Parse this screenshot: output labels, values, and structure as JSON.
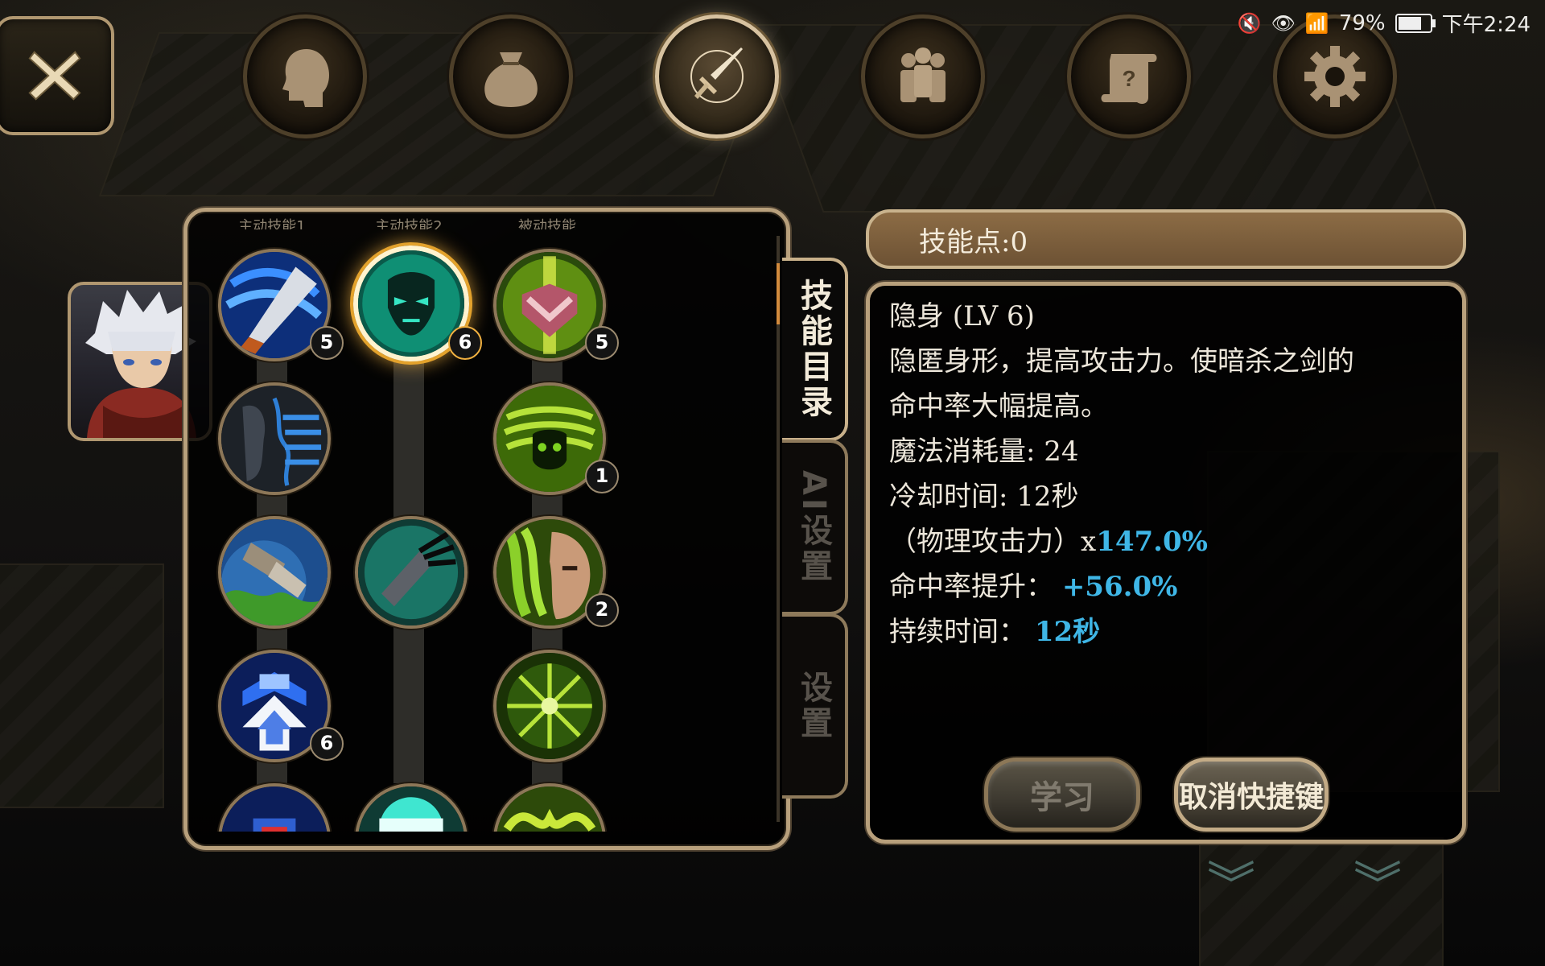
{
  "status_bar": {
    "battery": "79%",
    "time": "下午2:24",
    "icons": [
      "mute-icon",
      "eye-icon",
      "wifi-icon",
      "battery-icon"
    ]
  },
  "nav": {
    "close_icon": "close-icon",
    "tabs": [
      {
        "name": "character-tab",
        "icon": "head-icon",
        "active": false
      },
      {
        "name": "inventory-tab",
        "icon": "bag-icon",
        "active": false
      },
      {
        "name": "skills-tab",
        "icon": "sword-icon",
        "active": true
      },
      {
        "name": "party-tab",
        "icon": "people-icon",
        "active": false
      },
      {
        "name": "quest-tab",
        "icon": "scroll-icon",
        "active": false
      },
      {
        "name": "settings-tab",
        "icon": "gear-icon",
        "active": false
      }
    ]
  },
  "skill_panel": {
    "columns": [
      "主动技能1",
      "主动技能2",
      "被动技能"
    ],
    "skills": [
      {
        "name": "blade-slash-skill",
        "level": "5"
      },
      {
        "name": "stealth-skill",
        "level": "6",
        "selected": true
      },
      {
        "name": "heart-shield-skill",
        "level": "5"
      },
      {
        "name": "shadow-face-skill",
        "level": ""
      },
      {
        "name": "poison-mask-skill",
        "level": "1"
      },
      {
        "name": "earth-fist-skill",
        "level": ""
      },
      {
        "name": "claw-strike-skill",
        "level": ""
      },
      {
        "name": "green-face-skill",
        "level": "2"
      },
      {
        "name": "armor-boost-skill",
        "level": "6"
      },
      {
        "name": "burst-aura-skill",
        "level": ""
      }
    ]
  },
  "side_tabs": [
    {
      "label": "技能目录",
      "active": true
    },
    {
      "label": "AI设置",
      "active": false
    },
    {
      "label": "设置",
      "active": false
    }
  ],
  "skill_points": "技能点:0",
  "detail": {
    "title": "隐身 (LV 6)",
    "desc_line1": "隐匿身形，提高攻击力。使暗杀之剑的",
    "desc_line2": "命中率大幅提高。",
    "mana": "魔法消耗量: 24",
    "cooldown": "冷却时间: 12秒",
    "attack_label": "（物理攻击力）x",
    "attack_value": "147.0%",
    "hit_label": "命中率提升：",
    "hit_value": "+56.0%",
    "duration_label": "持续时间：",
    "duration_value": "12秒"
  },
  "buttons": {
    "learn": "学习",
    "cancel_shortcut": "取消快捷键"
  },
  "colors": {
    "accent_gold": "#b8a07c",
    "value_blue": "#3fb6e6",
    "selected_glow": "#f0b040"
  }
}
